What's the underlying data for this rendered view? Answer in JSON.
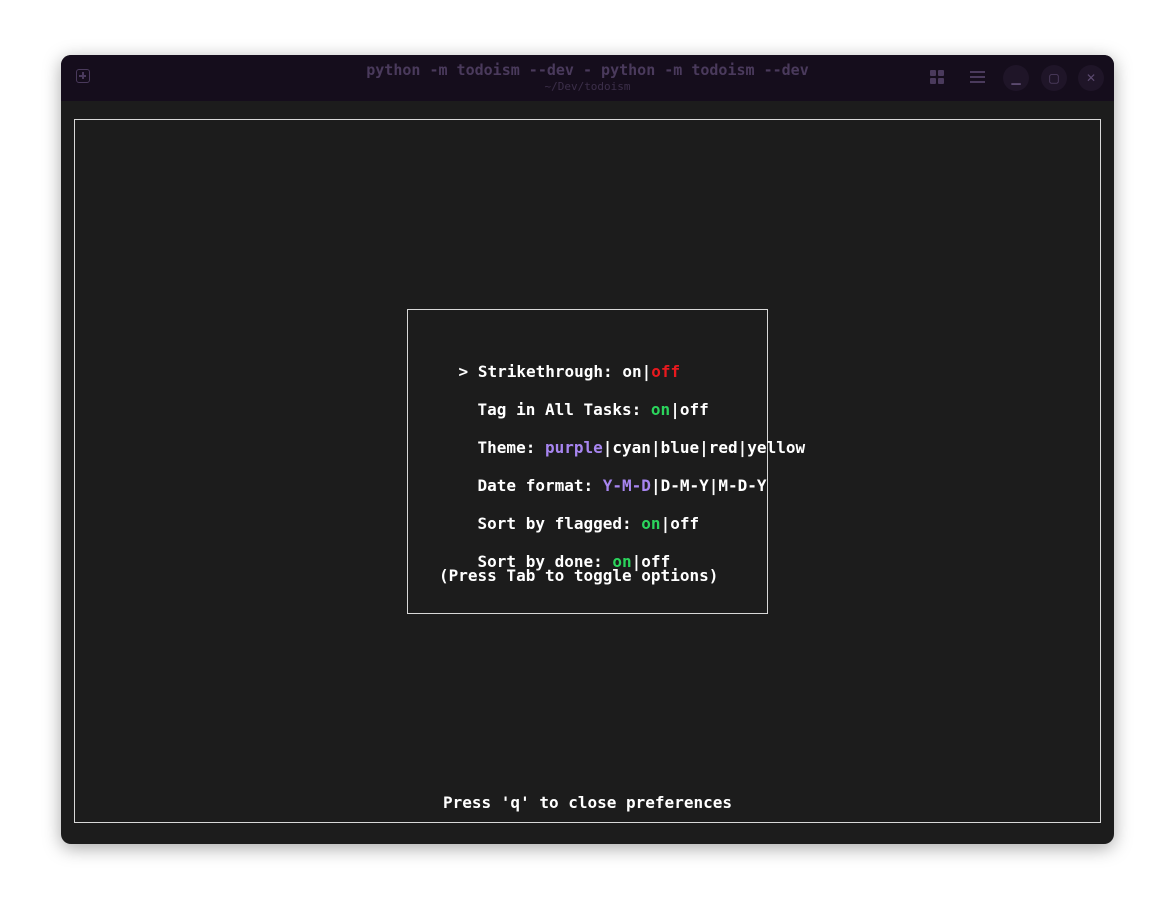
{
  "window": {
    "title": "python -m todoism --dev - python -m todoism --dev",
    "subtitle": "~/Dev/todoism"
  },
  "preferences": {
    "cursor": ">",
    "strikethrough": {
      "label": "Strikethrough: ",
      "options": [
        "on",
        "off"
      ],
      "selected": "off"
    },
    "tag_in_all_tasks": {
      "label": "Tag in All Tasks: ",
      "options": [
        "on",
        "off"
      ],
      "selected": "on"
    },
    "theme": {
      "label": "Theme: ",
      "options": [
        "purple",
        "cyan",
        "blue",
        "red",
        "yellow"
      ],
      "selected": "purple"
    },
    "date_format": {
      "label": "Date format: ",
      "options": [
        "Y-M-D",
        "D-M-Y",
        "M-D-Y"
      ],
      "selected": "Y-M-D"
    },
    "sort_by_flagged": {
      "label": "Sort by flagged: ",
      "options": [
        "on",
        "off"
      ],
      "selected": "on"
    },
    "sort_by_done": {
      "label": "Sort by done: ",
      "options": [
        "on",
        "off"
      ],
      "selected": "on"
    },
    "hint": "(Press Tab to toggle options)",
    "separator": "|"
  },
  "footer": "Press 'q' to close preferences",
  "colors": {
    "off_selected": "#e8191e",
    "on_selected": "#2bd45c",
    "theme_accent": "#a785f0"
  }
}
